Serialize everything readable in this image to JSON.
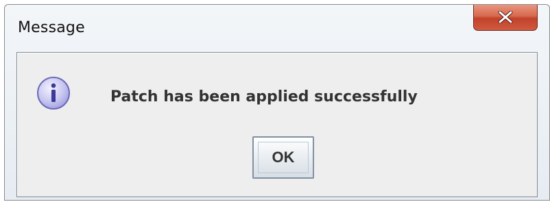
{
  "window": {
    "title": "Message",
    "close_icon": "close-icon"
  },
  "dialog": {
    "icon": "info-icon",
    "message": "Patch has been applied successfully",
    "ok_label": "OK"
  },
  "colors": {
    "close_button": "#c9452c",
    "info_icon_fill": "#c8c7f0",
    "info_icon_border": "#6c6ab8",
    "content_background": "#eeeeee"
  }
}
